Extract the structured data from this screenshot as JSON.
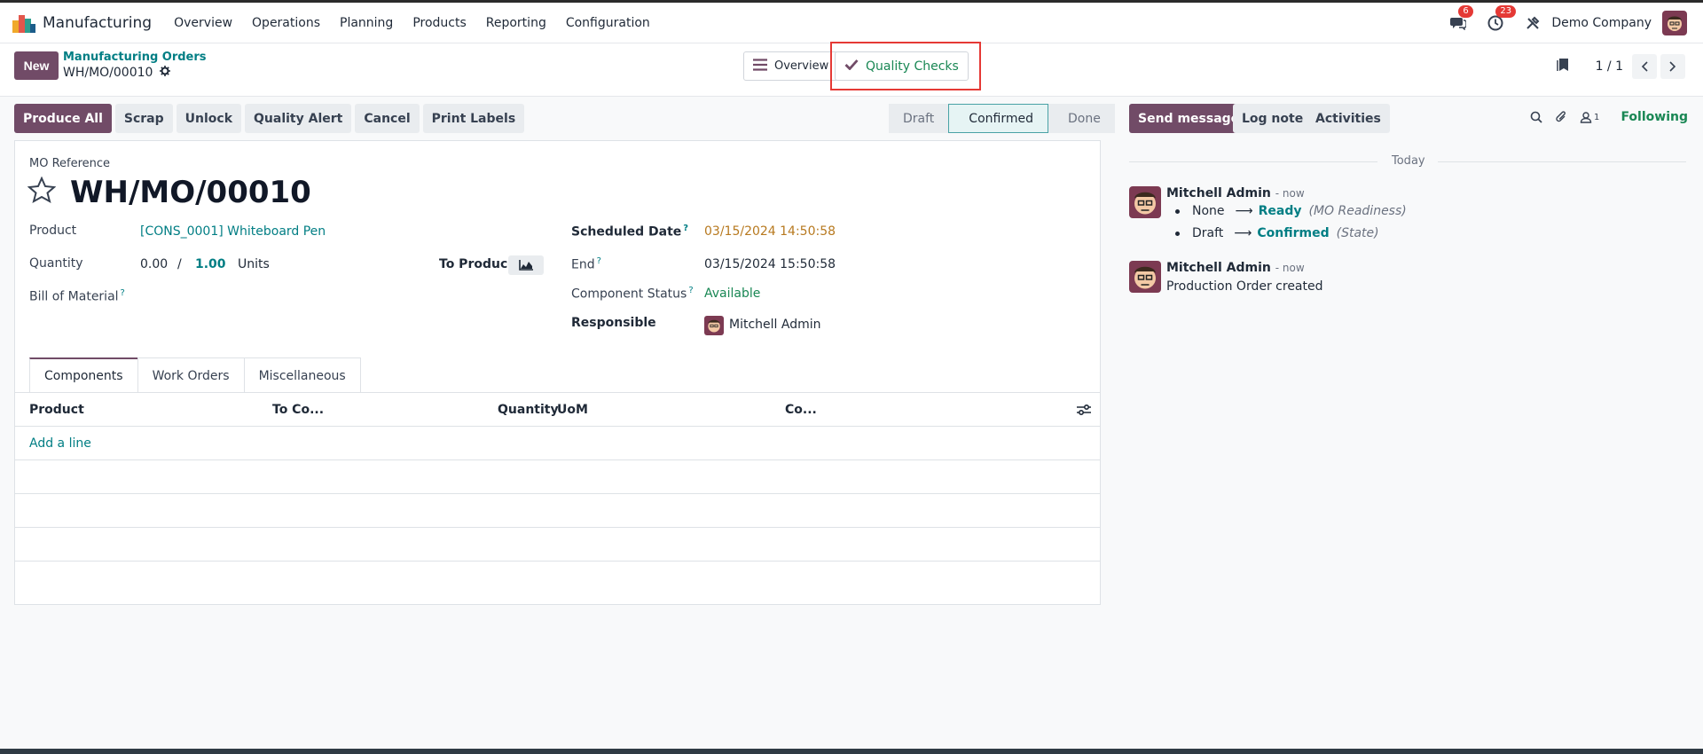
{
  "navbar": {
    "app_name": "Manufacturing",
    "menu": [
      "Overview",
      "Operations",
      "Planning",
      "Products",
      "Reporting",
      "Configuration"
    ],
    "messages_badge": "6",
    "activities_badge": "23",
    "company": "Demo Company",
    "icons": [
      "chat-icon",
      "clock-icon",
      "tools-icon"
    ]
  },
  "control": {
    "new_label": "New",
    "breadcrumb": "Manufacturing Orders",
    "record_name": "WH/MO/00010",
    "overview_label": "Overview",
    "quality_checks_label": "Quality Checks",
    "pager": "1 / 1"
  },
  "actions": [
    "Produce All",
    "Scrap",
    "Unlock",
    "Quality Alert",
    "Cancel",
    "Print Labels"
  ],
  "status": {
    "stages": [
      "Draft",
      "Confirmed",
      "Done"
    ],
    "active": "Confirmed"
  },
  "form": {
    "ref_label": "MO Reference",
    "title": "WH/MO/00010",
    "product_label": "Product",
    "product_value": "[CONS_0001] Whiteboard Pen",
    "quantity_label": "Quantity",
    "quantity_produced": "0.00",
    "quantity_sep": "/",
    "quantity_total": "1.00",
    "quantity_uom": "Units",
    "to_produce_label": "To Produce",
    "bom_label": "Bill of Material",
    "scheduled_label": "Scheduled Date",
    "scheduled_value": "03/15/2024 14:50:58",
    "end_label": "End",
    "end_value": "03/15/2024 15:50:58",
    "component_status_label": "Component Status",
    "component_status_value": "Available",
    "responsible_label": "Responsible",
    "responsible_value": "Mitchell Admin",
    "help_mark": "?",
    "colors": {
      "scheduled": "#b7791f",
      "available": "#198754",
      "link": "#017e84"
    }
  },
  "tabs": [
    "Components",
    "Work Orders",
    "Miscellaneous"
  ],
  "table": {
    "columns": [
      "Product",
      "To Co...",
      "Quantity",
      "UoM",
      "Co..."
    ],
    "add_line": "Add a line"
  },
  "chatter": {
    "send_message": "Send message",
    "log_note": "Log note",
    "activities": "Activities",
    "followers_count": "1",
    "following": "Following",
    "today": "Today",
    "messages": [
      {
        "author": "Mitchell Admin",
        "time": "- now",
        "changes": [
          {
            "old": "None",
            "arrow": "⟶",
            "new": "Ready",
            "field": "(MO Readiness)"
          },
          {
            "old": "Draft",
            "arrow": "⟶",
            "new": "Confirmed",
            "field": "(State)"
          }
        ]
      },
      {
        "author": "Mitchell Admin",
        "time": "- now",
        "body": "Production Order created"
      }
    ]
  }
}
